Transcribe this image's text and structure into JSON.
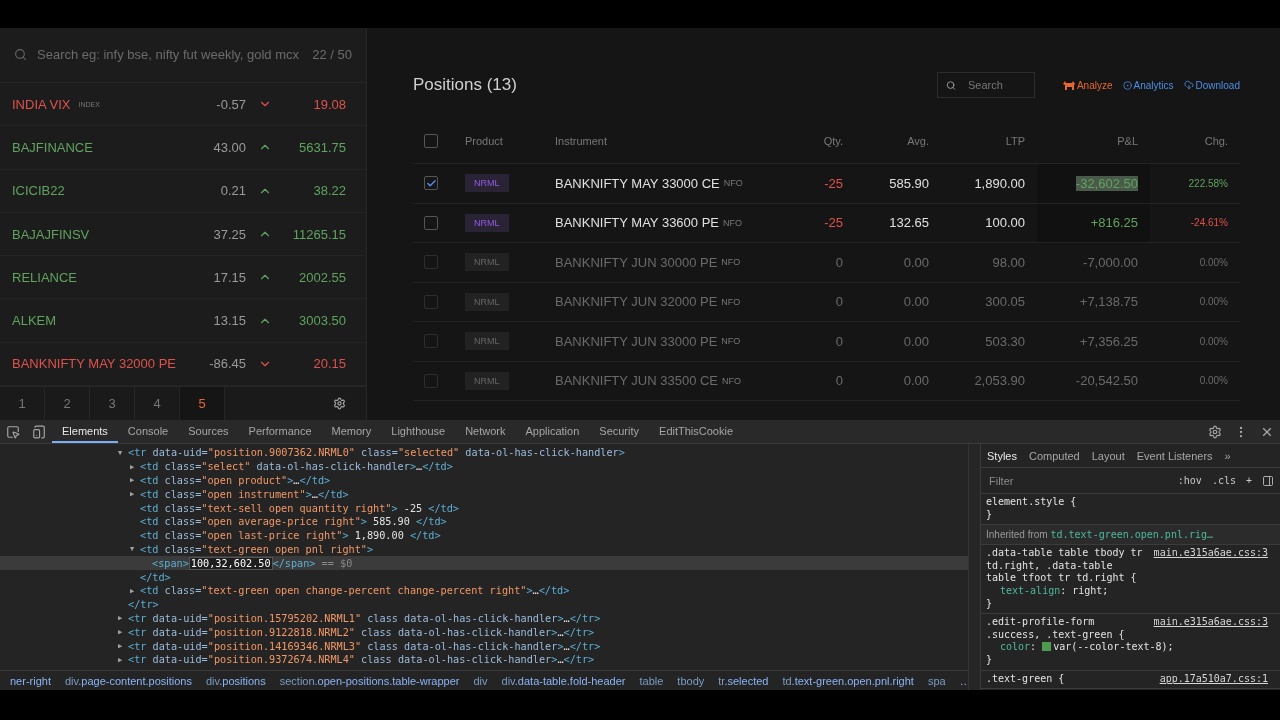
{
  "watchlist": {
    "search": {
      "placeholder": "Search eg: infy bse, nifty fut weekly, gold mcx"
    },
    "count": "22 / 50",
    "items": [
      {
        "name": "INDIA VIX",
        "tag": "INDEX",
        "change": "-0.57",
        "rising": false,
        "price": "19.08"
      },
      {
        "name": "BAJFINANCE",
        "change": "43.00",
        "rising": true,
        "price": "5631.75"
      },
      {
        "name": "ICICIB22",
        "change": "0.21",
        "rising": true,
        "price": "38.22"
      },
      {
        "name": "BAJAJFINSV",
        "change": "37.25",
        "rising": true,
        "price": "11265.15"
      },
      {
        "name": "RELIANCE",
        "change": "17.15",
        "rising": true,
        "price": "2002.55"
      },
      {
        "name": "ALKEM",
        "change": "13.15",
        "rising": true,
        "price": "3003.50"
      },
      {
        "name": "BANKNIFTY MAY 32000 PE",
        "change": "-86.45",
        "rising": false,
        "price": "20.15"
      }
    ],
    "pages": [
      {
        "label": "1",
        "selected": false
      },
      {
        "label": "2",
        "selected": false
      },
      {
        "label": "3",
        "selected": false
      },
      {
        "label": "4",
        "selected": false
      },
      {
        "label": "5",
        "selected": true
      }
    ]
  },
  "positions": {
    "title": "Positions (13)",
    "search": {
      "placeholder": "Search"
    },
    "links": [
      {
        "label": "Analyze",
        "kind": "analyze"
      },
      {
        "label": "Analytics",
        "kind": "analytics"
      },
      {
        "label": "Download",
        "kind": "download"
      }
    ],
    "select_all": {
      "checked": false
    },
    "columns": [
      "Product",
      "Instrument",
      "Qty.",
      "Avg.",
      "LTP",
      "P&L",
      "Chg."
    ],
    "rows": [
      {
        "checked": true,
        "open": true,
        "product": "NRML",
        "instrument": "BANKNIFTY MAY 33000 CE",
        "exchange": "NFO",
        "qty": "-25",
        "avg": "585.90",
        "ltp": "1,890.00",
        "pnl": "-32,602.50",
        "pnl_text_selected": true,
        "chg": "222.58%",
        "chg_gain": true
      },
      {
        "checked": false,
        "open": true,
        "product": "NRML",
        "instrument": "BANKNIFTY MAY 33600 PE",
        "exchange": "NFO",
        "qty": "-25",
        "avg": "132.65",
        "ltp": "100.00",
        "pnl": "+816.25",
        "pnl_text_selected": false,
        "chg": "-24.61%",
        "chg_gain": false
      },
      {
        "checked": false,
        "open": false,
        "product": "NRML",
        "instrument": "BANKNIFTY JUN 30000 PE",
        "exchange": "NFO",
        "qty": "0",
        "avg": "0.00",
        "ltp": "98.00",
        "pnl": "-7,000.00",
        "pnl_text_selected": false,
        "chg": "0.00%"
      },
      {
        "checked": false,
        "open": false,
        "product": "NRML",
        "instrument": "BANKNIFTY JUN 32000 PE",
        "exchange": "NFO",
        "qty": "0",
        "avg": "0.00",
        "ltp": "300.05",
        "pnl": "+7,138.75",
        "pnl_text_selected": false,
        "chg": "0.00%"
      },
      {
        "checked": false,
        "open": false,
        "product": "NRML",
        "instrument": "BANKNIFTY JUN 33000 PE",
        "exchange": "NFO",
        "qty": "0",
        "avg": "0.00",
        "ltp": "503.30",
        "pnl": "+7,356.25",
        "pnl_text_selected": false,
        "chg": "0.00%"
      },
      {
        "checked": false,
        "open": false,
        "product": "NRML",
        "instrument": "BANKNIFTY JUN 33500 CE",
        "exchange": "NFO",
        "qty": "0",
        "avg": "0.00",
        "ltp": "2,053.90",
        "pnl": "-20,542.50",
        "pnl_text_selected": false,
        "chg": "0.00%"
      }
    ]
  },
  "devtools": {
    "tabs": [
      {
        "label": "Elements",
        "selected": true
      },
      {
        "label": "Console",
        "selected": false
      },
      {
        "label": "Sources",
        "selected": false
      },
      {
        "label": "Performance",
        "selected": false
      },
      {
        "label": "Memory",
        "selected": false
      },
      {
        "label": "Lighthouse",
        "selected": false
      },
      {
        "label": "Network",
        "selected": false
      },
      {
        "label": "Application",
        "selected": false
      },
      {
        "label": "Security",
        "selected": false
      },
      {
        "label": "EditThisCookie",
        "selected": false
      }
    ],
    "dom_tree": [
      {
        "arrow": "▼",
        "selected": false,
        "tokens": [
          {
            "kind": "tag",
            "text": "<tr"
          },
          {
            "kind": "attr",
            "text": " data-uid="
          },
          {
            "kind": "value",
            "text": "\"position.9007362.NRML0\""
          },
          {
            "kind": "attr",
            "text": " class="
          },
          {
            "kind": "value",
            "text": "\"selected\""
          },
          {
            "kind": "attr",
            "text": " data-ol-has-click-handler"
          },
          {
            "kind": "tag",
            "text": ">"
          }
        ],
        "children": [
          {
            "arrow": "▶",
            "selected": false,
            "tokens": [
              {
                "kind": "tag",
                "text": "<td"
              },
              {
                "kind": "attr",
                "text": " class="
              },
              {
                "kind": "value",
                "text": "\"select\""
              },
              {
                "kind": "attr",
                "text": " data-ol-has-click-handler"
              },
              {
                "kind": "tag",
                "text": ">"
              },
              {
                "kind": "text",
                "text": "…"
              },
              {
                "kind": "tag",
                "text": "</td>"
              }
            ]
          },
          {
            "arrow": "▶",
            "selected": false,
            "tokens": [
              {
                "kind": "tag",
                "text": "<td"
              },
              {
                "kind": "attr",
                "text": " class="
              },
              {
                "kind": "value",
                "text": "\"open product\""
              },
              {
                "kind": "tag",
                "text": ">"
              },
              {
                "kind": "text",
                "text": "…"
              },
              {
                "kind": "tag",
                "text": "</td>"
              }
            ]
          },
          {
            "arrow": "▶",
            "selected": false,
            "tokens": [
              {
                "kind": "tag",
                "text": "<td"
              },
              {
                "kind": "attr",
                "text": " class="
              },
              {
                "kind": "value",
                "text": "\"open instrument\""
              },
              {
                "kind": "tag",
                "text": ">"
              },
              {
                "kind": "text",
                "text": "…"
              },
              {
                "kind": "tag",
                "text": "</td>"
              }
            ]
          },
          {
            "selected": false,
            "tokens": [
              {
                "kind": "tag",
                "text": "<td"
              },
              {
                "kind": "attr",
                "text": " class="
              },
              {
                "kind": "value",
                "text": "\"text-sell open quantity right\""
              },
              {
                "kind": "tag",
                "text": ">"
              },
              {
                "kind": "text",
                "text": " -25 "
              },
              {
                "kind": "tag",
                "text": "</td>"
              }
            ]
          },
          {
            "selected": false,
            "tokens": [
              {
                "kind": "tag",
                "text": "<td"
              },
              {
                "kind": "attr",
                "text": " class="
              },
              {
                "kind": "value",
                "text": "\"open average-price right\""
              },
              {
                "kind": "tag",
                "text": ">"
              },
              {
                "kind": "text",
                "text": " 585.90 "
              },
              {
                "kind": "tag",
                "text": "</td>"
              }
            ]
          },
          {
            "selected": false,
            "tokens": [
              {
                "kind": "tag",
                "text": "<td"
              },
              {
                "kind": "attr",
                "text": " class="
              },
              {
                "kind": "value",
                "text": "\"open last-price right\""
              },
              {
                "kind": "tag",
                "text": ">"
              },
              {
                "kind": "text",
                "text": " 1,890.00 "
              },
              {
                "kind": "tag",
                "text": "</td>"
              }
            ]
          },
          {
            "arrow": "▼",
            "selected": false,
            "tokens": [
              {
                "kind": "tag",
                "text": "<td"
              },
              {
                "kind": "attr",
                "text": " class="
              },
              {
                "kind": "value",
                "text": "\"text-green open pnl right\""
              },
              {
                "kind": "tag",
                "text": ">"
              }
            ],
            "children": [
              {
                "selected": true,
                "tokens": [
                  {
                    "kind": "tag",
                    "text": "<span>"
                  },
                  {
                    "kind": "edit",
                    "text": "100,32,602.50"
                  },
                  {
                    "kind": "tag",
                    "text": "</span>"
                  },
                  {
                    "kind": "hint",
                    "text": " == $0"
                  }
                ]
              }
            ],
            "closing": [
              {
                "kind": "tag",
                "text": "</td>"
              }
            ]
          },
          {
            "arrow": "▶",
            "selected": false,
            "tokens": [
              {
                "kind": "tag",
                "text": "<td"
              },
              {
                "kind": "attr",
                "text": " class="
              },
              {
                "kind": "value",
                "text": "\"text-green open change-percent change-percent right\""
              },
              {
                "kind": "tag",
                "text": ">"
              },
              {
                "kind": "text",
                "text": "…"
              },
              {
                "kind": "tag",
                "text": "</td>"
              }
            ]
          }
        ],
        "closing": [
          {
            "kind": "tag",
            "text": "</tr>"
          }
        ]
      },
      {
        "arrow": "▶",
        "selected": false,
        "tokens": [
          {
            "kind": "tag",
            "text": "<tr"
          },
          {
            "kind": "attr",
            "text": " data-uid="
          },
          {
            "kind": "value",
            "text": "\"position.15795202.NRML1\""
          },
          {
            "kind": "attr",
            "text": " class data-ol-has-click-handler"
          },
          {
            "kind": "tag",
            "text": ">"
          },
          {
            "kind": "text",
            "text": "…"
          },
          {
            "kind": "tag",
            "text": "</tr>"
          }
        ]
      },
      {
        "arrow": "▶",
        "selected": false,
        "tokens": [
          {
            "kind": "tag",
            "text": "<tr"
          },
          {
            "kind": "attr",
            "text": " data-uid="
          },
          {
            "kind": "value",
            "text": "\"position.9122818.NRML2\""
          },
          {
            "kind": "attr",
            "text": " class data-ol-has-click-handler"
          },
          {
            "kind": "tag",
            "text": ">"
          },
          {
            "kind": "text",
            "text": "…"
          },
          {
            "kind": "tag",
            "text": "</tr>"
          }
        ]
      },
      {
        "arrow": "▶",
        "selected": false,
        "tokens": [
          {
            "kind": "tag",
            "text": "<tr"
          },
          {
            "kind": "attr",
            "text": " data-uid="
          },
          {
            "kind": "value",
            "text": "\"position.14169346.NRML3\""
          },
          {
            "kind": "attr",
            "text": " class data-ol-has-click-handler"
          },
          {
            "kind": "tag",
            "text": ">"
          },
          {
            "kind": "text",
            "text": "…"
          },
          {
            "kind": "tag",
            "text": "</tr>"
          }
        ]
      },
      {
        "arrow": "▶",
        "selected": false,
        "tokens": [
          {
            "kind": "tag",
            "text": "<tr"
          },
          {
            "kind": "attr",
            "text": " data-uid="
          },
          {
            "kind": "value",
            "text": "\"position.9372674.NRML4\""
          },
          {
            "kind": "attr",
            "text": " class data-ol-has-click-handler"
          },
          {
            "kind": "tag",
            "text": ">"
          },
          {
            "kind": "text",
            "text": "…"
          },
          {
            "kind": "tag",
            "text": "</tr>"
          }
        ]
      }
    ],
    "breadcrumbs": [
      {
        "classes": "ner-right"
      },
      {
        "tag": "div",
        "classes": ".page-content.positions"
      },
      {
        "tag": "div",
        "classes": ".positions"
      },
      {
        "tag": "section",
        "classes": ".open-positions.table-wrapper"
      },
      {
        "tag": "div"
      },
      {
        "tag": "div",
        "classes": ".data-table.fold-header"
      },
      {
        "tag": "table"
      },
      {
        "tag": "tbody"
      },
      {
        "tag": "tr",
        "classes": ".selected"
      },
      {
        "tag": "td",
        "classes": ".text-green.open.pnl.right"
      },
      {
        "tag": "spa"
      }
    ],
    "breadcrumb_more": "…",
    "side_tabs": [
      {
        "label": "Styles",
        "selected": true
      },
      {
        "label": "Computed",
        "selected": false
      },
      {
        "label": "Layout",
        "selected": false
      },
      {
        "label": "Event Listeners",
        "selected": false
      }
    ],
    "side_more": "»",
    "filter": {
      "placeholder": "Filter"
    },
    "filter_buttons": [
      ":hov",
      ".cls",
      "+"
    ],
    "rules": [
      {
        "kind": "rule",
        "selector": "element.style {",
        "close": "}"
      },
      {
        "kind": "inherited",
        "label": "Inherited from ",
        "target": "td.text-green.open.pnl.rig…"
      },
      {
        "kind": "rule",
        "selector": ".data-table table tbody tr td.right, .data-table table tfoot tr td.right {",
        "source": "main.e315a6ae.css:3",
        "declarations": [
          {
            "property": "text-align",
            "colon": ": ",
            "value": "right;"
          }
        ],
        "close": "}"
      },
      {
        "kind": "rule",
        "selector": ".edit-profile-form .success, .text-green {",
        "source": "main.e315a6ae.css:3",
        "declarations": [
          {
            "property": "color",
            "colon": ": ",
            "color": "#4e9a4e",
            "value": "var(--color-text-8);"
          }
        ],
        "close": "}"
      },
      {
        "kind": "rule",
        "selector": ".text-green {",
        "source": "app.17a510a7.css:1"
      }
    ]
  }
}
